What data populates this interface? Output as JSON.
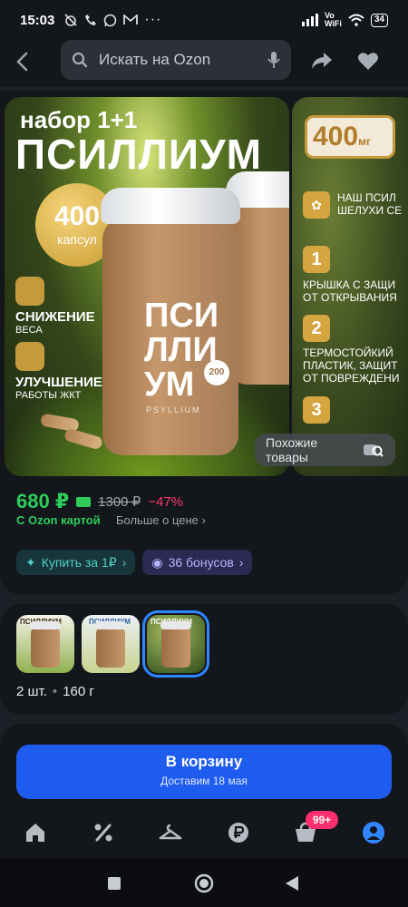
{
  "status_bar": {
    "time": "15:03",
    "signal_label_top": "Vo",
    "signal_label_bottom": "WiFi",
    "battery": "34"
  },
  "header": {
    "search_placeholder": "Искать на Ozon"
  },
  "gallery": {
    "image1": {
      "line1": "набор 1+1",
      "brand": "ПСИЛЛИУМ",
      "badge_number": "400",
      "badge_unit": "капсул",
      "features": [
        {
          "title": "СНИЖЕНИЕ",
          "subtitle": "ВЕСА"
        },
        {
          "title": "УЛУЧШЕНИЕ",
          "subtitle": "РАБОТЫ ЖКТ"
        }
      ],
      "jar_text": "ПСИ\nЛЛИ\nУМ",
      "jar_sub": "PSYLLIUM",
      "jar_count": "200"
    },
    "image2": {
      "weight": "400",
      "weight_unit": "мг",
      "rows": [
        {
          "num": "",
          "text": "НАШ ПСИЛ\nШЕЛУХИ СЕ"
        },
        {
          "num": "1",
          "text": "КРЫШКА С ЗАЩИ\nОТ ОТКРЫВАНИЯ"
        },
        {
          "num": "2",
          "text": "ТЕРМОСТОЙКИЙ\nПЛАСТИК, ЗАЩИТ\nОТ ПОВРЕЖДЕНИ"
        },
        {
          "num": "3",
          "text": ""
        }
      ]
    },
    "similar_label": "Похожие товары"
  },
  "price": {
    "current": "680 ₽",
    "old": "1300 ₽",
    "discount": "−47%",
    "ozon_card": "С Ozon картой",
    "more": "Больше о цене"
  },
  "chips": {
    "buy": "Купить за 1₽",
    "bonus": "36 бонусов"
  },
  "variants": {
    "thumbs": [
      {
        "title": "ПСИЛЛИУМ"
      },
      {
        "title": "ПСИЛЛИУМ"
      },
      {
        "title": "ПСИЛЛИУМ"
      }
    ],
    "count": "2 шт.",
    "weight": "160 г"
  },
  "cart": {
    "label": "В корзину",
    "delivery": "Доставим 18 мая"
  },
  "tabbar": {
    "cart_badge": "99+"
  },
  "colors": {
    "accent": "#1e5cf0",
    "price_green": "#2ecc5b",
    "discount": "#ff3b6b",
    "badge": "#ff2e6e"
  }
}
